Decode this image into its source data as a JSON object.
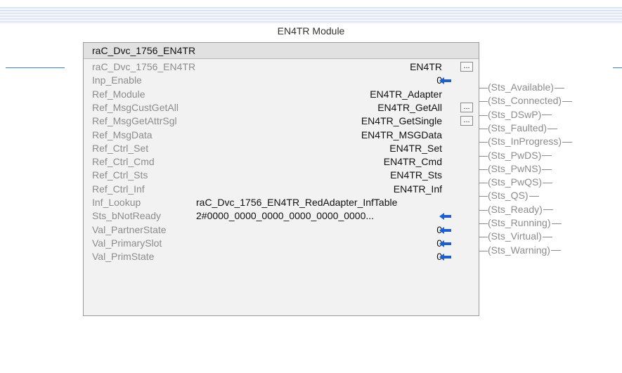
{
  "rung": {
    "title": "EN4TR Module"
  },
  "block": {
    "title": "raC_Dvc_1756_EN4TR",
    "params": [
      {
        "name": "raC_Dvc_1756_EN4TR",
        "value": "EN4TR",
        "ellipsis": true,
        "arrow": false
      },
      {
        "name": "Inp_Enable",
        "value": "0",
        "ellipsis": false,
        "arrow": true
      },
      {
        "name": "Ref_Module",
        "value": "EN4TR_Adapter",
        "ellipsis": false,
        "arrow": false
      },
      {
        "name": "Ref_MsgCustGetAll",
        "value": "EN4TR_GetAll",
        "ellipsis": true,
        "arrow": false
      },
      {
        "name": "Ref_MsgGetAttrSgl",
        "value": "EN4TR_GetSingle",
        "ellipsis": true,
        "arrow": false
      },
      {
        "name": "Ref_MsgData",
        "value": "EN4TR_MSGData",
        "ellipsis": false,
        "arrow": false
      },
      {
        "name": "Ref_Ctrl_Set",
        "value": "EN4TR_Set",
        "ellipsis": false,
        "arrow": false
      },
      {
        "name": "Ref_Ctrl_Cmd",
        "value": "EN4TR_Cmd",
        "ellipsis": false,
        "arrow": false
      },
      {
        "name": "Ref_Ctrl_Sts",
        "value": "EN4TR_Sts",
        "ellipsis": false,
        "arrow": false
      },
      {
        "name": "Ref_Ctrl_Inf",
        "value": "EN4TR_Inf",
        "ellipsis": false,
        "arrow": false
      },
      {
        "name": "Inf_Lookup",
        "value": "raC_Dvc_1756_EN4TR_RedAdapter_InfTable",
        "ellipsis": false,
        "arrow": false,
        "wide": true
      },
      {
        "name": "Sts_bNotReady",
        "value": "2#0000_0000_0000_0000_0000_0000...",
        "ellipsis": false,
        "arrow": true,
        "wide": true
      },
      {
        "name": "Val_PartnerState",
        "value": "0",
        "ellipsis": false,
        "arrow": true
      },
      {
        "name": "Val_PrimarySlot",
        "value": "0",
        "ellipsis": false,
        "arrow": true
      },
      {
        "name": "Val_PrimState",
        "value": "0",
        "ellipsis": false,
        "arrow": true
      }
    ],
    "outputs": [
      "Sts_Available",
      "Sts_Connected",
      "Sts_DSwP",
      "Sts_Faulted",
      "Sts_InProgress",
      "Sts_PwDS",
      "Sts_PwNS",
      "Sts_PwQS",
      "Sts_QS",
      "Sts_Ready",
      "Sts_Running",
      "Sts_Virtual",
      "Sts_Warning"
    ]
  },
  "colors": {
    "rail": "#3a7fc4",
    "arrow": "#1f5fc9",
    "param_name": "#8c8c8c"
  },
  "icons": {
    "arrow": "left-arrow-icon",
    "ellipsis": "browse-ellipsis-button"
  }
}
